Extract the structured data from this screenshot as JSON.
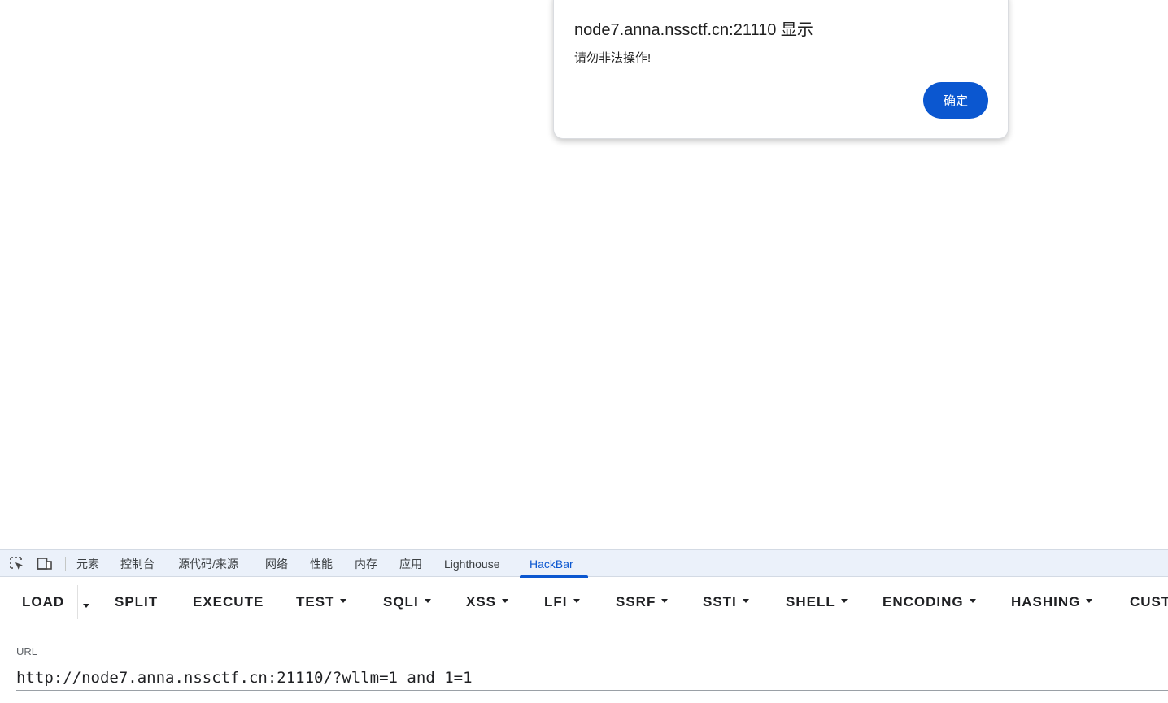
{
  "alert": {
    "title": "node7.anna.nssctf.cn:21110 显示",
    "message": "请勿非法操作!",
    "ok_label": "确定",
    "accent_color": "#0b57d0"
  },
  "devtools": {
    "icons": [
      "element-picker-icon",
      "device-toolbar-icon"
    ],
    "tabs": [
      {
        "label": "元素"
      },
      {
        "label": "控制台"
      },
      {
        "label": "源代码/来源"
      },
      {
        "label": "网络"
      },
      {
        "label": "性能"
      },
      {
        "label": "内存"
      },
      {
        "label": "应用"
      },
      {
        "label": "Lighthouse"
      },
      {
        "label": "HackBar"
      }
    ],
    "active_tab": "HackBar"
  },
  "hackbar": {
    "buttons": [
      {
        "label": "LOAD"
      },
      {
        "label": "SPLIT"
      },
      {
        "label": "EXECUTE"
      },
      {
        "label": "TEST"
      },
      {
        "label": "SQLI"
      },
      {
        "label": "XSS"
      },
      {
        "label": "LFI"
      },
      {
        "label": "SSRF"
      },
      {
        "label": "SSTI"
      },
      {
        "label": "SHELL"
      },
      {
        "label": "ENCODING"
      },
      {
        "label": "HASHING"
      },
      {
        "label": "CUST"
      }
    ],
    "url_label": "URL",
    "url_value": "http://node7.anna.nssctf.cn:21110/?wllm=1 and 1=1"
  }
}
